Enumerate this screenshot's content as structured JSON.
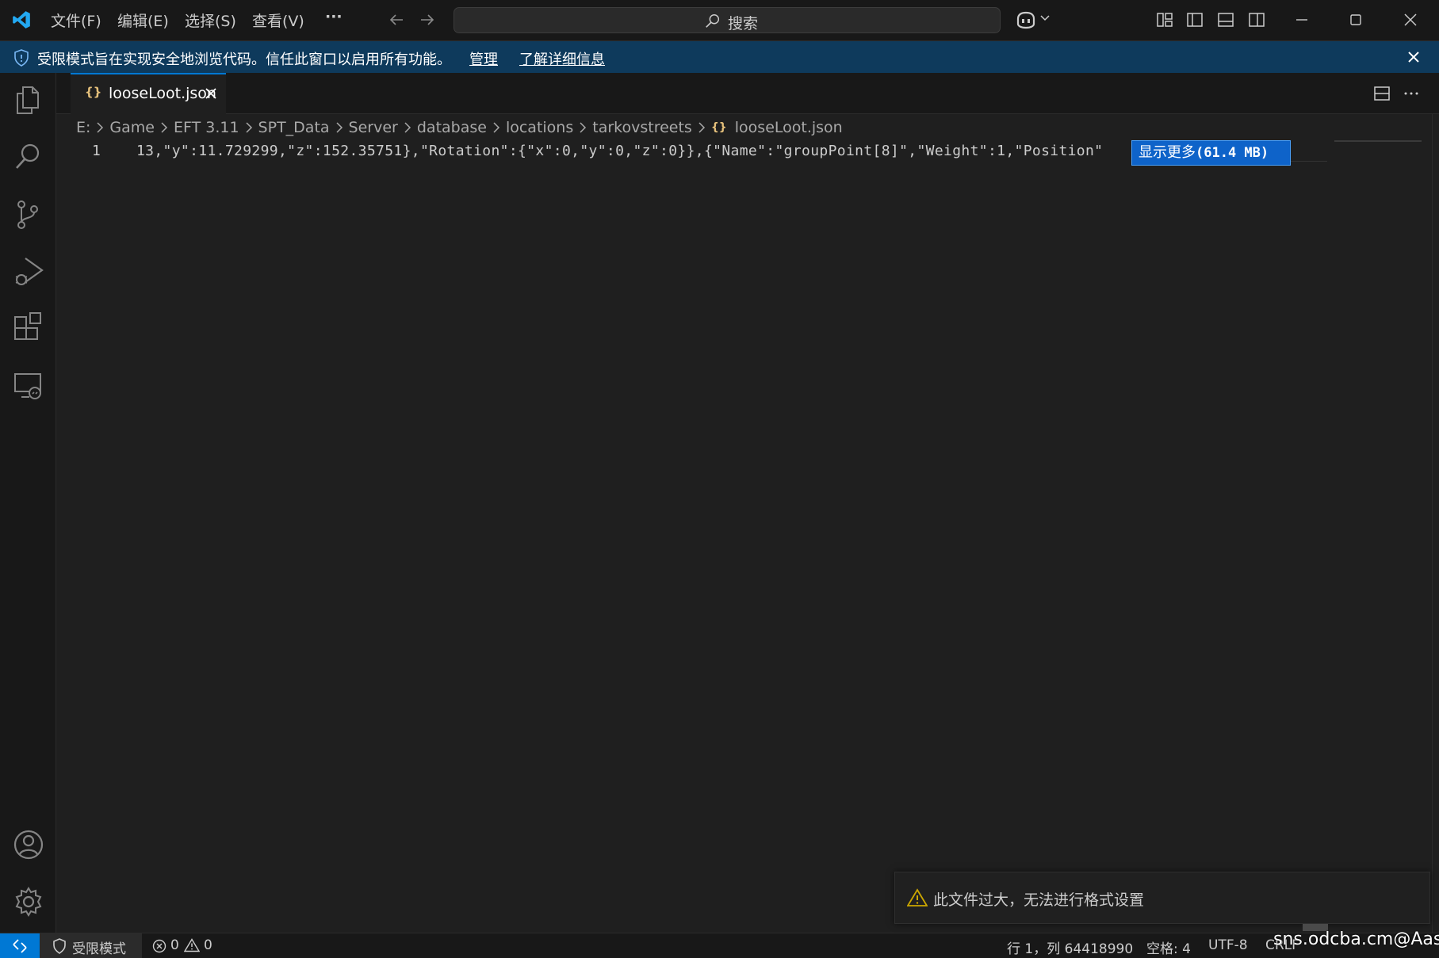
{
  "titlebar": {
    "menus": [
      "文件(F)",
      "编辑(E)",
      "选择(S)",
      "查看(V)"
    ],
    "more": "···",
    "search_placeholder": "搜索"
  },
  "banner": {
    "message": "受限模式旨在实现安全地浏览代码。信任此窗口以启用所有功能。",
    "manage": "管理",
    "learn_more": "了解详细信息"
  },
  "tab": {
    "braces": "{}",
    "name": "looseLoot.json"
  },
  "breadcrumb": [
    "E:",
    "Game",
    "EFT 3.11",
    "SPT_Data",
    "Server",
    "database",
    "locations",
    "tarkovstreets",
    "looseLoot.json"
  ],
  "editor": {
    "line_number": "1",
    "code": "13,\"y\":11.729299,\"z\":152.35751},\"Rotation\":{\"x\":0,\"y\":0,\"z\":0}},{\"Name\":\"groupPoint[8]\",\"Weight\":1,\"Position\"",
    "show_more_label": "显示更多",
    "show_more_size": "(61.4 MB)"
  },
  "notification": {
    "message": "此文件过大，无法进行格式设置"
  },
  "statusbar": {
    "restricted_mode": "受限模式",
    "errors": "0",
    "warnings": "0",
    "position": "行 1，列 64418990",
    "spaces": "空格: 4",
    "encoding": "UTF-8",
    "eol": "CRLF"
  },
  "watermark": "sns.odcba.cm@Aasd",
  "colors": {
    "accent": "#0078d4",
    "banner": "#0e3a5c",
    "editor_bg": "#1f1f1f",
    "chrome_bg": "#181818",
    "warning": "#cca700"
  }
}
